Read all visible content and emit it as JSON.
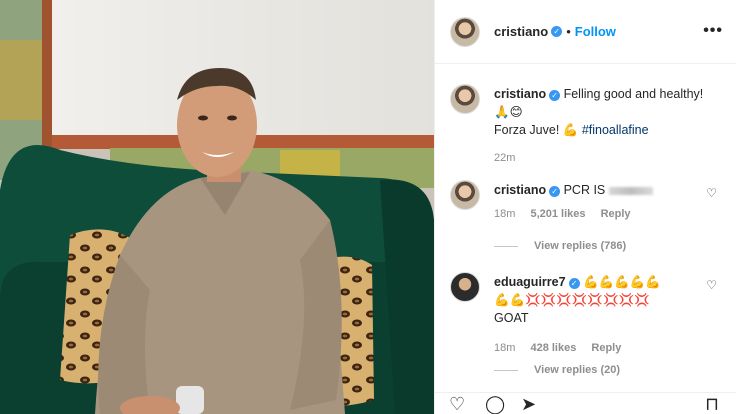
{
  "post": {
    "author": "cristiano",
    "follow_label": "Follow",
    "more_icon": "more-options-icon",
    "dot": "•",
    "verified_glyph": "✓"
  },
  "caption": {
    "author": "cristiano",
    "line1": "Felling good and healthy!",
    "line2_emoji": "🙏😊",
    "line3_text": "Forza Juve! 💪",
    "hashtag": "#finoallafine",
    "time": "22m"
  },
  "comments": [
    {
      "author": "cristiano",
      "text": "PCR IS",
      "time": "18m",
      "likes": "5,201 likes",
      "reply": "Reply",
      "view_replies": "View replies (786)"
    },
    {
      "author": "eduaguirre7",
      "line1": "💪💪💪💪💪",
      "line2": "💪💪💢💢💢💢💢💢💢💢",
      "line3": "GOAT",
      "time": "18m",
      "likes": "428 likes",
      "reply": "Reply",
      "view_replies": "View replies (20)"
    }
  ],
  "actions": {
    "like_icon": "heart-icon",
    "comment_icon": "comment-icon",
    "share_icon": "share-icon",
    "save_icon": "bookmark-icon"
  }
}
